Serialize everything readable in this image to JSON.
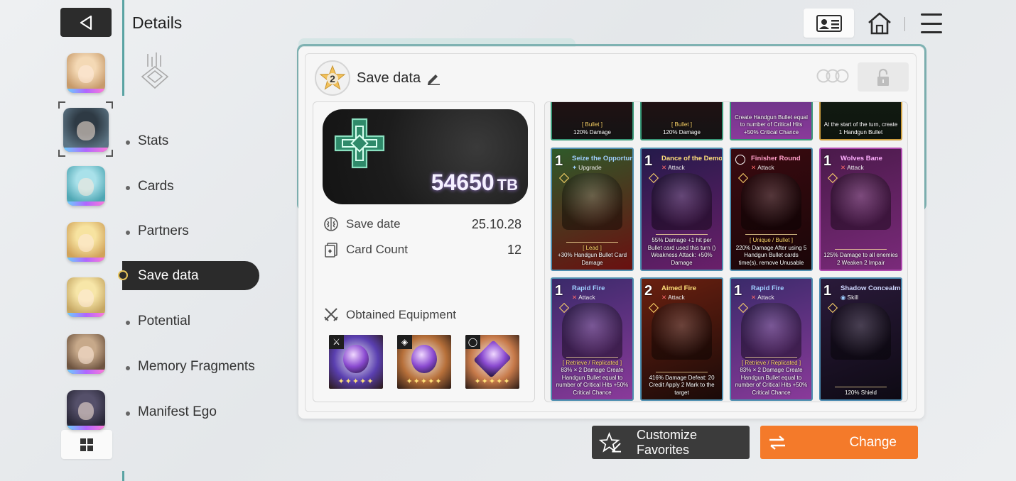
{
  "header": {
    "title": "Details",
    "back_icon": "back-triangle-icon",
    "profile_icon": "id-card-icon",
    "home_icon": "home-icon",
    "menu_icon": "hamburger-menu-icon"
  },
  "characters": [
    {
      "name": "character-1",
      "palette": [
        "#f4d9b5",
        "#c79a6a"
      ]
    },
    {
      "name": "character-2",
      "palette": [
        "#2e3a44",
        "#5c7484"
      ],
      "selected": true
    },
    {
      "name": "character-3",
      "palette": [
        "#a9e1ea",
        "#4fa7b4"
      ]
    },
    {
      "name": "character-4",
      "palette": [
        "#f7e3a0",
        "#d1a35a"
      ]
    },
    {
      "name": "character-5",
      "palette": [
        "#f7e6a8",
        "#c6a763"
      ]
    },
    {
      "name": "character-6",
      "palette": [
        "#c7a98a",
        "#6e5440"
      ]
    },
    {
      "name": "character-7",
      "palette": [
        "#55506a",
        "#2a2838"
      ]
    }
  ],
  "nav": {
    "items": [
      "Stats",
      "Cards",
      "Partners",
      "Save data",
      "Potential",
      "Memory Fragments",
      "Manifest Ego"
    ],
    "active": "Save data"
  },
  "save": {
    "rank": "2",
    "title": "Save data",
    "amount": "54650",
    "unit": "TB",
    "save_date_label": "Save date",
    "save_date": "25.10.28",
    "card_count_label": "Card Count",
    "card_count": "12",
    "equipment_label": "Obtained Equipment",
    "equipment": [
      {
        "slot": "weapon",
        "slot_icon": "sword-icon",
        "stars": "✦✦✦✦✦",
        "color": "#5a3fb0"
      },
      {
        "slot": "armor",
        "slot_icon": "armor-icon",
        "stars": "✦✦✦✦✦",
        "color": "#b7703a"
      },
      {
        "slot": "ring",
        "slot_icon": "ring-icon",
        "stars": "✦✦✦✦✦",
        "color": "#c77a4a"
      }
    ]
  },
  "cards_top_row": [
    {
      "tag": "[ Bullet ]",
      "desc": "120% Damage"
    },
    {
      "tag": "[ Bullet ]",
      "desc": "120% Damage"
    },
    {
      "tag": "",
      "desc": "Create Handgun Bullet equal to number of Critical Hits +50% Critical Chance"
    },
    {
      "tag": "",
      "desc": "At the start of the turn, create 1 Handgun Bullet"
    }
  ],
  "cards": [
    {
      "cost": "1",
      "name": "Seize the Opportunity",
      "type": "Upgrade",
      "type_icon": "upgrade",
      "tag": "[ Lead ]",
      "desc": "+30% Handgun Bullet Card Damage",
      "bg": [
        "#2f5a2a",
        "#6a1010"
      ],
      "name_color": "#9fd0ff"
    },
    {
      "cost": "1",
      "name": "Dance of the Demon",
      "type": "Attack",
      "type_icon": "x",
      "tag": "",
      "desc": "55% Damage +1 hit per Bullet card used this turn () Weakness Attack: +50% Damage",
      "bg": [
        "#241a4a",
        "#6a1f6a"
      ],
      "name_color": "#ffe17a"
    },
    {
      "cost": "",
      "name": "Finisher Round",
      "type": "Attack",
      "type_icon": "x",
      "tag": "[ Unique / Bullet ]",
      "desc": "220% Damage After using 5 Handgun Bullet cards  time(s), remove Unusable",
      "bg": [
        "#3a0a10",
        "#1a0608"
      ],
      "name_color": "#ff9ec8"
    },
    {
      "cost": "1",
      "name": "Wolves Bane",
      "type": "Attack",
      "type_icon": "x",
      "tag": "",
      "desc": "125% Damage to all enemies 2 Weaken 2 Impair",
      "bg": [
        "#4a1a4a",
        "#7a2a7a"
      ],
      "name_color": "#ffb0ff"
    },
    {
      "cost": "1",
      "name": "Rapid Fire",
      "type": "Attack",
      "type_icon": "x",
      "tag": "[ Retrieve / Replicated ]",
      "desc": "83% × 2 Damage Create Handgun Bullet equal to number of Critical Hits +50% Critical Chance",
      "bg": [
        "#3a2a6a",
        "#8a3a9a"
      ],
      "name_color": "#9fd0ff"
    },
    {
      "cost": "2",
      "name": "Aimed Fire",
      "type": "Attack",
      "type_icon": "x",
      "tag": "",
      "desc": "416% Damage Defeat: 20 Credit Apply 2 Mark to the target",
      "bg": [
        "#6a2010",
        "#1a0a08"
      ],
      "name_color": "#ffe17a"
    },
    {
      "cost": "1",
      "name": "Rapid Fire",
      "type": "Attack",
      "type_icon": "x",
      "tag": "[ Retrieve / Replicated ]",
      "desc": "83% × 2 Damage Create Handgun Bullet equal to number of Critical Hits +50% Critical Chance",
      "bg": [
        "#3a2a6a",
        "#8a3a9a"
      ],
      "name_color": "#9fd0ff"
    },
    {
      "cost": "1",
      "name": "Shadow Concealment",
      "type": "Skill",
      "type_icon": "skill",
      "tag": "",
      "desc": "120% Shield",
      "bg": [
        "#2a1a3a",
        "#0e0a14"
      ],
      "name_color": "#d0d8ff"
    }
  ],
  "buttons": {
    "favorites": "Customize Favorites",
    "change": "Change"
  },
  "colors": {
    "accent_orange": "#f47a2a",
    "dark": "#2b2b2b",
    "teal": "#5aa3a3"
  }
}
